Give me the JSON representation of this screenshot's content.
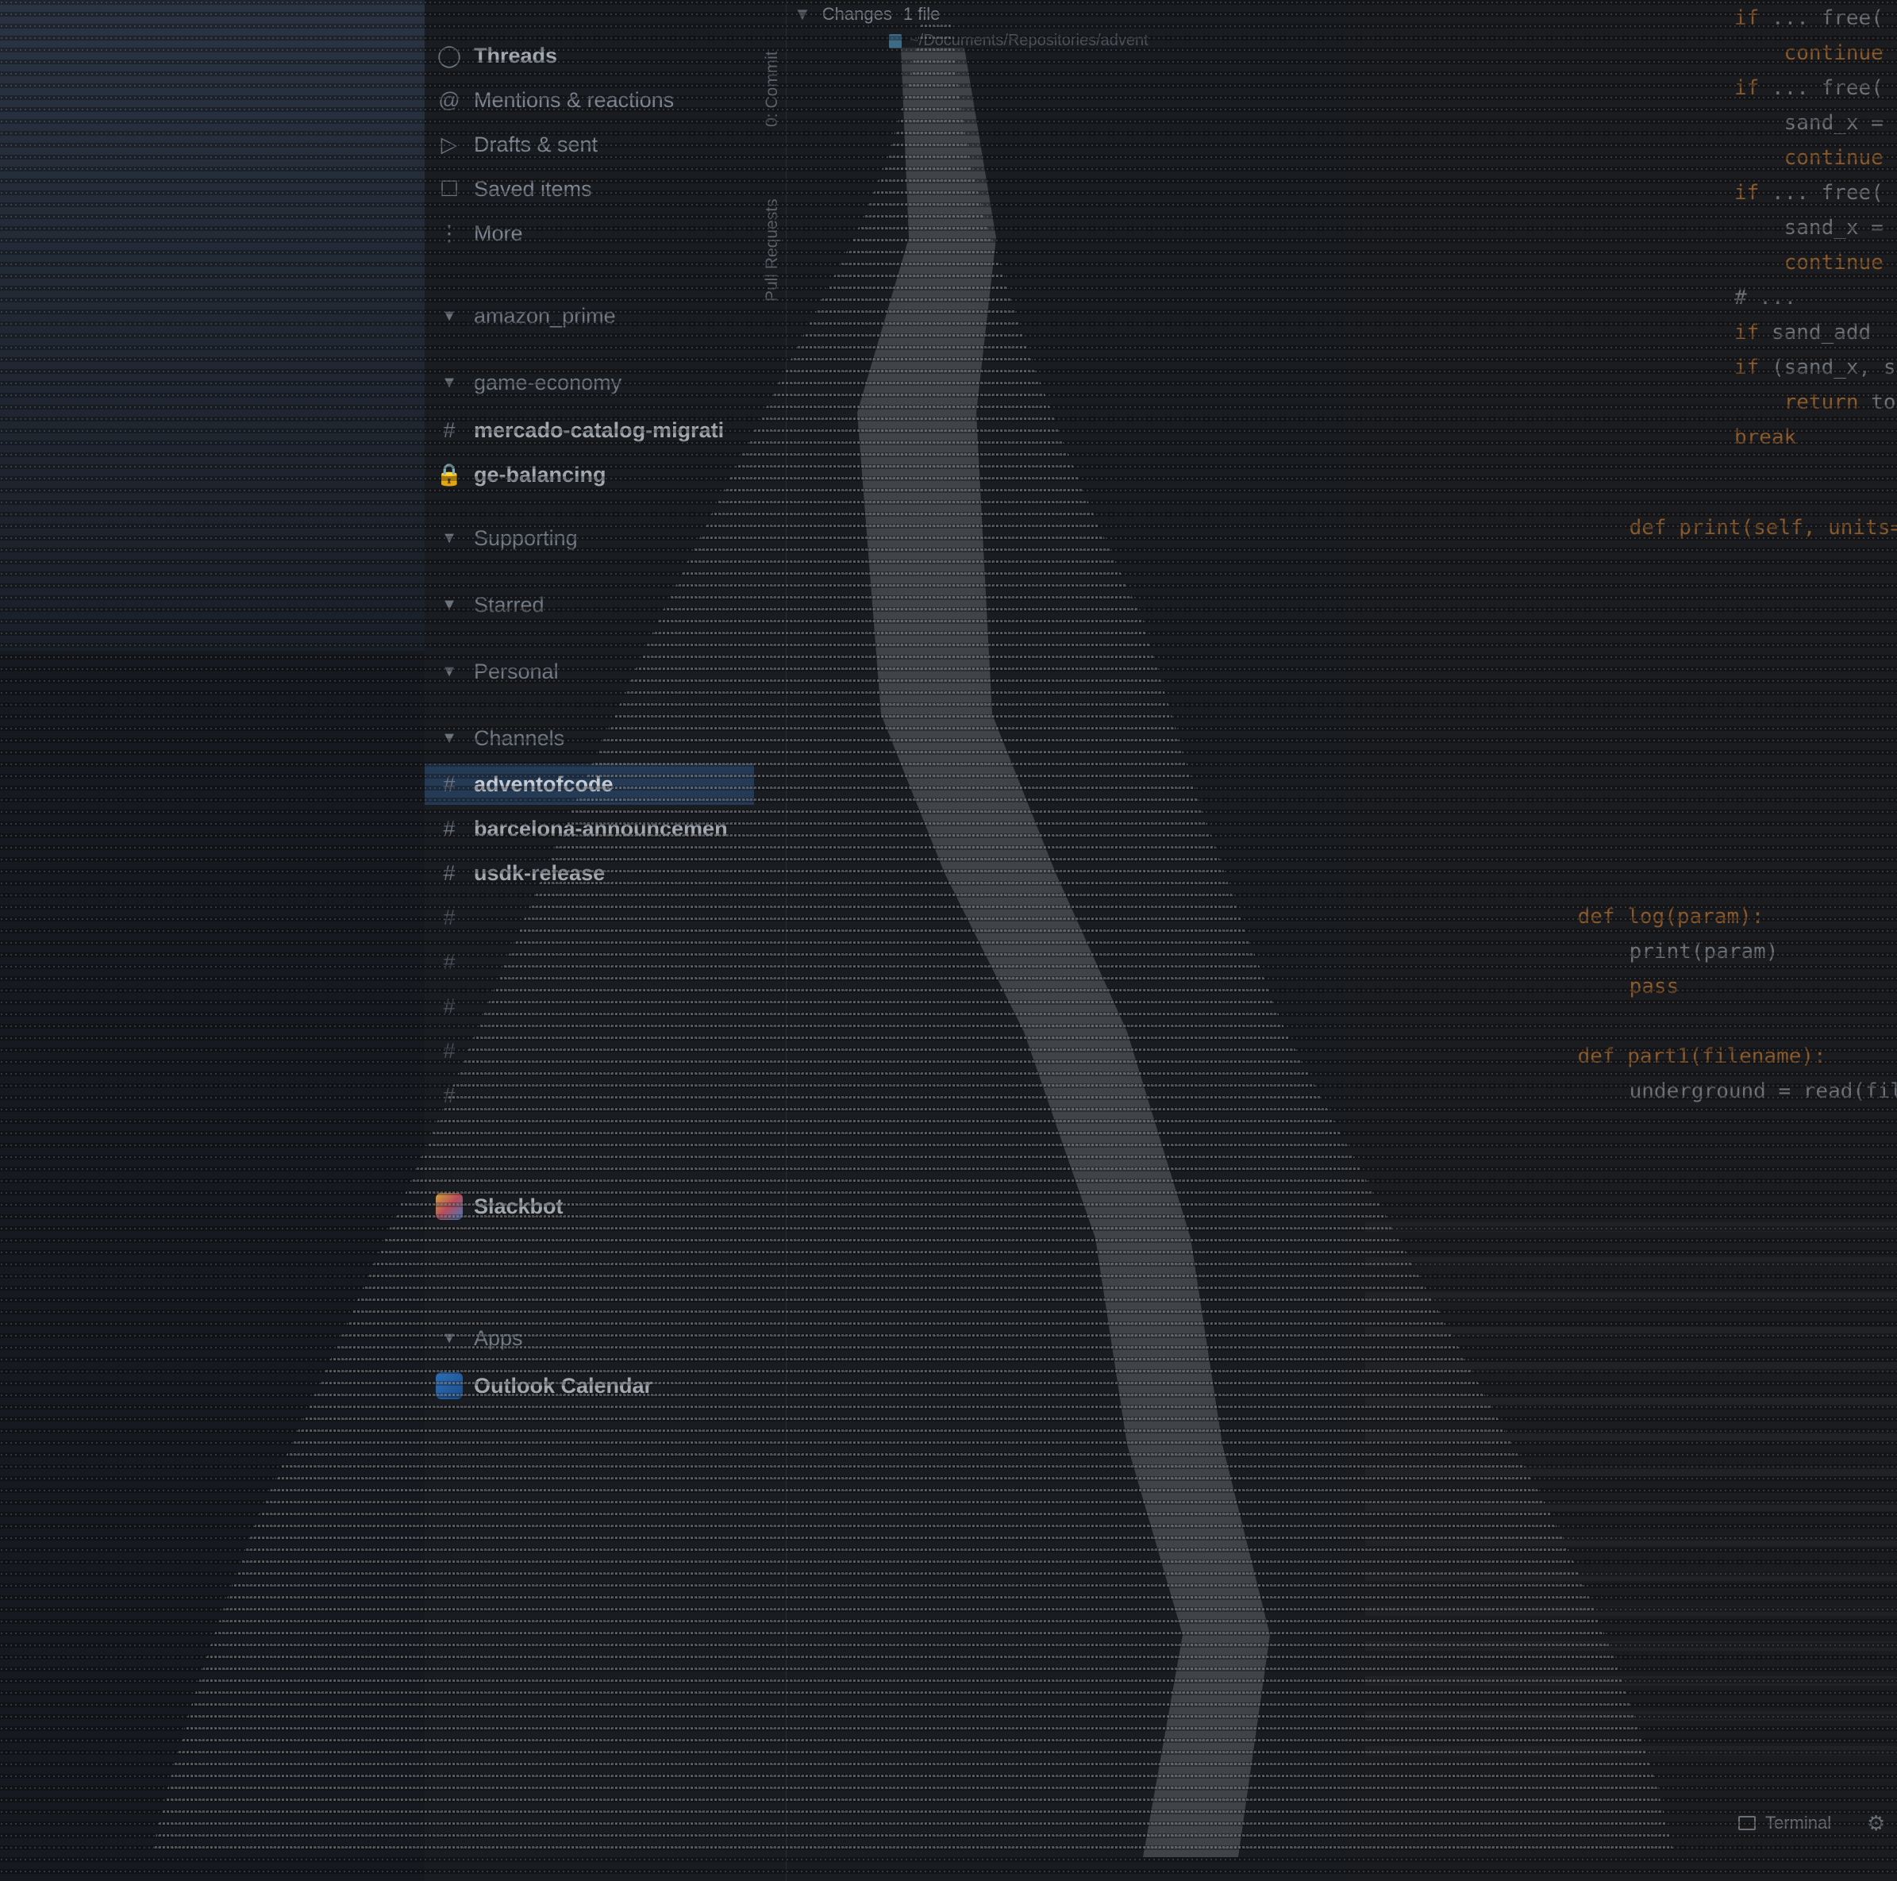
{
  "sidebar": {
    "threads": "Threads",
    "mentions": "Mentions & reactions",
    "drafts": "Drafts & sent",
    "saved": "Saved items",
    "more": "More",
    "sections": {
      "amazon_prime": "amazon_prime",
      "game_economy": "game-economy",
      "supporting": "Supporting",
      "starred": "Starred",
      "personal": "Personal",
      "channels": "Channels",
      "apps": "Apps"
    },
    "channels": {
      "mercado": "mercado-catalog-migrati",
      "ge_balancing": "ge-balancing",
      "adventofcode": "adventofcode",
      "barcelona": "barcelona-announcemen",
      "usdk": "usdk-release"
    },
    "dm": {
      "slackbot": "Slackbot"
    },
    "apps": {
      "outlook": "Outlook Calendar"
    }
  },
  "git": {
    "commit_label": "0: Commit",
    "pullrequests_label": "Pull Requests",
    "changes_header": "Changes",
    "changes_count": "1 file",
    "file_path": "~/Documents/Repositories/advent"
  },
  "ide": {
    "code_lines": [
      {
        "parts": [
          [
            "kw",
            "if"
          ],
          [
            "tx",
            " ... free("
          ]
        ]
      },
      {
        "parts": [
          [
            "kw",
            "    continue"
          ]
        ]
      },
      {
        "parts": [
          [
            "kw",
            "if"
          ],
          [
            "tx",
            " ... free("
          ]
        ]
      },
      {
        "parts": [
          [
            "tx",
            "    sand_x = ..."
          ]
        ]
      },
      {
        "parts": [
          [
            "kw",
            "    continue"
          ]
        ]
      },
      {
        "parts": [
          [
            "kw",
            "if"
          ],
          [
            "tx",
            " ... free("
          ]
        ]
      },
      {
        "parts": [
          [
            "tx",
            "    sand_x = ..."
          ]
        ]
      },
      {
        "parts": [
          [
            "kw",
            "    continue"
          ]
        ]
      },
      {
        "parts": [
          [
            "tx",
            "# ..."
          ]
        ]
      },
      {
        "parts": [
          [
            "kw",
            "if"
          ],
          [
            "tx",
            " sand_add"
          ]
        ]
      },
      {
        "parts": [
          [
            "kw",
            "if"
          ],
          [
            "tx",
            " (sand_x, s"
          ]
        ]
      },
      {
        "parts": [
          [
            "kw",
            "    return"
          ],
          [
            "tx",
            " to"
          ]
        ]
      },
      {
        "parts": [
          [
            "kw",
            "break"
          ]
        ]
      }
    ],
    "print_def": "def print(self, units=...):",
    "log_def": "def log(param):",
    "log_body": "print(param)",
    "pass_kw": "pass",
    "part1_def": "def part1(filename):",
    "part1_body": "underground = read(filena",
    "terminal_label": "Terminal"
  },
  "colors": {
    "background": "#16191f",
    "selected": "#253a55",
    "keyword": "#8a5a2c",
    "function": "#9a8a3e"
  }
}
